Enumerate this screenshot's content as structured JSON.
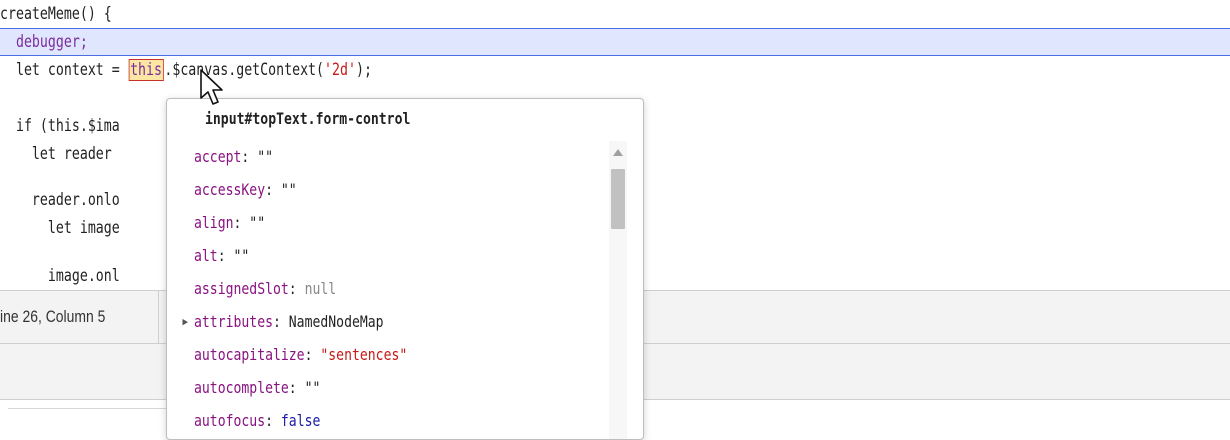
{
  "editor": {
    "lines": [
      {
        "text": "createMeme() {"
      },
      {
        "text": "  debugger;"
      },
      {
        "pre": "  let context = ",
        "this_token": "this",
        "mid": ".$canvas.getContext(",
        "str": "'2d'",
        "post": ");"
      },
      {
        "text": ""
      },
      {
        "text": "  if (this.$ima"
      },
      {
        "text": "    let reader "
      },
      {
        "text": ""
      },
      {
        "text": "    reader.onlo"
      },
      {
        "text": "      let image"
      },
      {
        "text": ""
      },
      {
        "text": "      image.onl"
      }
    ]
  },
  "status_bar": {
    "position_text": "ine 26, Column 5"
  },
  "popover": {
    "title": "input#topText.form-control",
    "properties": [
      {
        "name": "accept",
        "value": "\"\"",
        "kind": "empty"
      },
      {
        "name": "accessKey",
        "value": "\"\"",
        "kind": "empty"
      },
      {
        "name": "align",
        "value": "\"\"",
        "kind": "empty"
      },
      {
        "name": "alt",
        "value": "\"\"",
        "kind": "empty"
      },
      {
        "name": "assignedSlot",
        "value": "null",
        "kind": "null"
      },
      {
        "name": "attributes",
        "value": "NamedNodeMap",
        "kind": "obj",
        "expandable": true
      },
      {
        "name": "autocapitalize",
        "value": "\"sentences\"",
        "kind": "str"
      },
      {
        "name": "autocomplete",
        "value": "\"\"",
        "kind": "empty"
      },
      {
        "name": "autofocus",
        "value": "false",
        "kind": "bool"
      }
    ]
  },
  "icons": {
    "disclosure": "disclosure-triangle-icon",
    "scroll_up": "scroll-up-arrow-icon",
    "cursor": "mouse-pointer-icon"
  },
  "colors": {
    "highlight_line": "#dfe6fd",
    "highlight_border": "#4b6ee0",
    "property_name": "#881280",
    "string_value": "#c41a16",
    "keyword": "#7a2d9c"
  }
}
